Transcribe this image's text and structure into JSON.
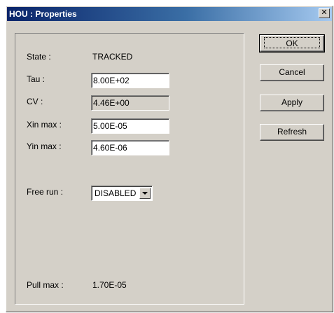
{
  "window": {
    "title": "HOU : Properties",
    "close_glyph": "✕"
  },
  "fields": {
    "state": {
      "label": "State :",
      "value": "TRACKED"
    },
    "tau": {
      "label": "Tau :",
      "value": "8.00E+02"
    },
    "cv": {
      "label": "CV :",
      "value": "4.46E+00"
    },
    "xin_max": {
      "label": "Xin max :",
      "value": "5.00E-05"
    },
    "yin_max": {
      "label": "Yin max :",
      "value": "4.60E-06"
    },
    "free_run": {
      "label": "Free run :",
      "selected": "DISABLED"
    },
    "pull_max": {
      "label": "Pull max :",
      "value": "1.70E-05"
    }
  },
  "buttons": {
    "ok": "OK",
    "cancel": "Cancel",
    "apply": "Apply",
    "refresh": "Refresh"
  },
  "icons": {
    "close": "close-icon",
    "dropdown": "chevron-down-icon"
  },
  "colors": {
    "title_gradient_start": "#0a246a",
    "title_gradient_end": "#a6caf0",
    "face": "#d4d0c8"
  }
}
